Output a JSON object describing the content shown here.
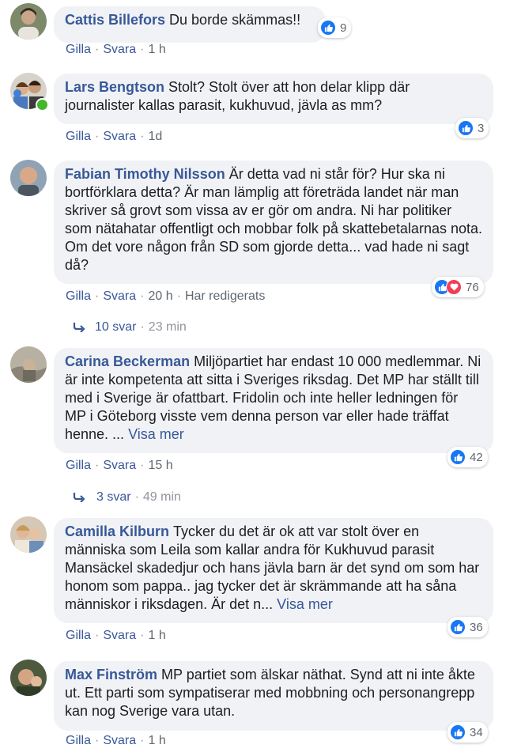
{
  "actions": {
    "like": "Gilla",
    "reply": "Svara",
    "separator": "·"
  },
  "comments": [
    {
      "author": "Cattis Billefors",
      "text": "Du borde skämmas!!",
      "time": "1 h",
      "reactions": "9"
    },
    {
      "author": "Lars Bengtson",
      "text": "Stolt? Stolt över att hon delar klipp där journalister kallas parasit, kukhuvud, jävla as mm?",
      "time": "1d",
      "reactions": "3"
    },
    {
      "author": "Fabian Timothy Nilsson",
      "text": "Är detta vad ni står för? Hur ska ni bortförklara detta? Är man lämplig att företräda landet när man skriver så grovt som vissa av er gör om andra. Ni har politiker som nätahatar offentligt och mobbar folk på skattebetalarnas nota. Om det vore någon från SD som gjorde detta... vad hade ni sagt då?",
      "time": "20 h",
      "edited": "Har redigerats",
      "reactions": "76",
      "replies": "10 svar",
      "replies_time": "23 min"
    },
    {
      "author": "Carina Beckerman",
      "text": "Miljöpartiet har endast 10 000 medlemmar. Ni är inte kompetenta att sitta i Sveriges riksdag. Det MP har ställt till med i Sverige är ofattbart. Fridolin och inte heller ledningen för MP i Göteborg visste vem denna person var eller hade träffat henne. ...",
      "see_more": "Visa mer",
      "time": "15 h",
      "reactions": "42",
      "replies": "3 svar",
      "replies_time": "49 min"
    },
    {
      "author": "Camilla Kilburn",
      "text": "Tycker du det är ok att var stolt över en människa som Leila som kallar andra för Kukhuvud parasit Mansäckel skadedjur och hans jävla barn är det synd om som har honom som pappa.. jag tycker det är skrämmande att ha såna människor i riksdagen. Är det n...",
      "see_more": "Visa mer",
      "time": "1 h",
      "reactions": "36"
    },
    {
      "author": "Max Finström",
      "text": "MP partiet som älskar näthat. Synd att ni inte åkte ut. Ett parti som sympatiserar med mobbning och personangrepp kan nog Sverige vara utan.",
      "time": "1 h",
      "reactions": "34"
    }
  ]
}
